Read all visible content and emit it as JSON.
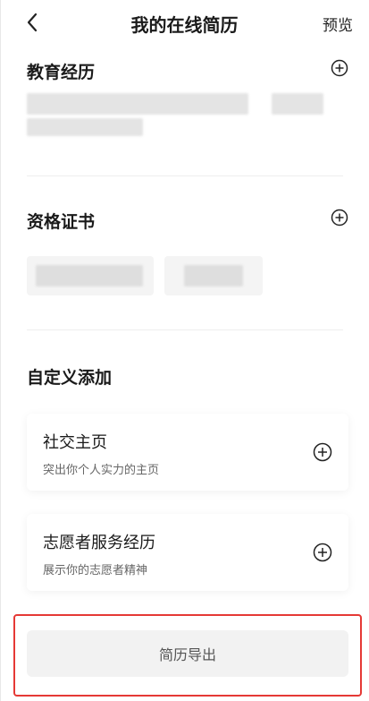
{
  "header": {
    "title": "我的在线简历",
    "preview": "预览"
  },
  "education": {
    "title": "教育经历"
  },
  "certificates": {
    "title": "资格证书"
  },
  "custom": {
    "title": "自定义添加",
    "cards": [
      {
        "title": "社交主页",
        "subtitle": "突出你个人实力的主页"
      },
      {
        "title": "志愿者服务经历",
        "subtitle": "展示你的志愿者精神"
      }
    ]
  },
  "footer": {
    "export_label": "简历导出"
  },
  "colors": {
    "highlight": "#e53935",
    "button_bg": "#f2f2f2"
  },
  "icons": {
    "back": "chevron-left-icon",
    "add": "plus-circle-icon"
  }
}
